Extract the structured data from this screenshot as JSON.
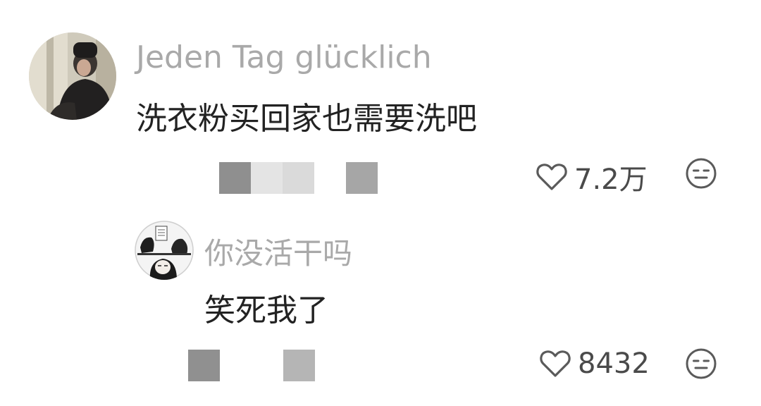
{
  "comments": [
    {
      "username": "Jeden Tag glücklich",
      "text": "洗衣粉买回家也需要洗吧",
      "like_count": "7.2万",
      "avatar_icon": "user-avatar-photo",
      "like_icon": "heart-outline-icon",
      "dislike_icon": "meh-face-icon",
      "redacted_tiles": [
        "#8f8f8f",
        "#e4e4e4",
        "#dadada",
        "#ffffff",
        "#a6a6a6"
      ]
    },
    {
      "username": "你没活干吗",
      "text": "笑死我了",
      "like_count": "8432",
      "avatar_icon": "manga-avatar",
      "like_icon": "heart-outline-icon",
      "dislike_icon": "meh-face-icon",
      "redacted_tiles": [
        "#909090",
        "#ffffff",
        "#ffffff",
        "#b5b5b5"
      ]
    }
  ],
  "colors": {
    "username": "#a9a9a9",
    "comment_text": "#222222",
    "count_text": "#4a4a4a",
    "icon_stroke": "#5a5a5a"
  }
}
